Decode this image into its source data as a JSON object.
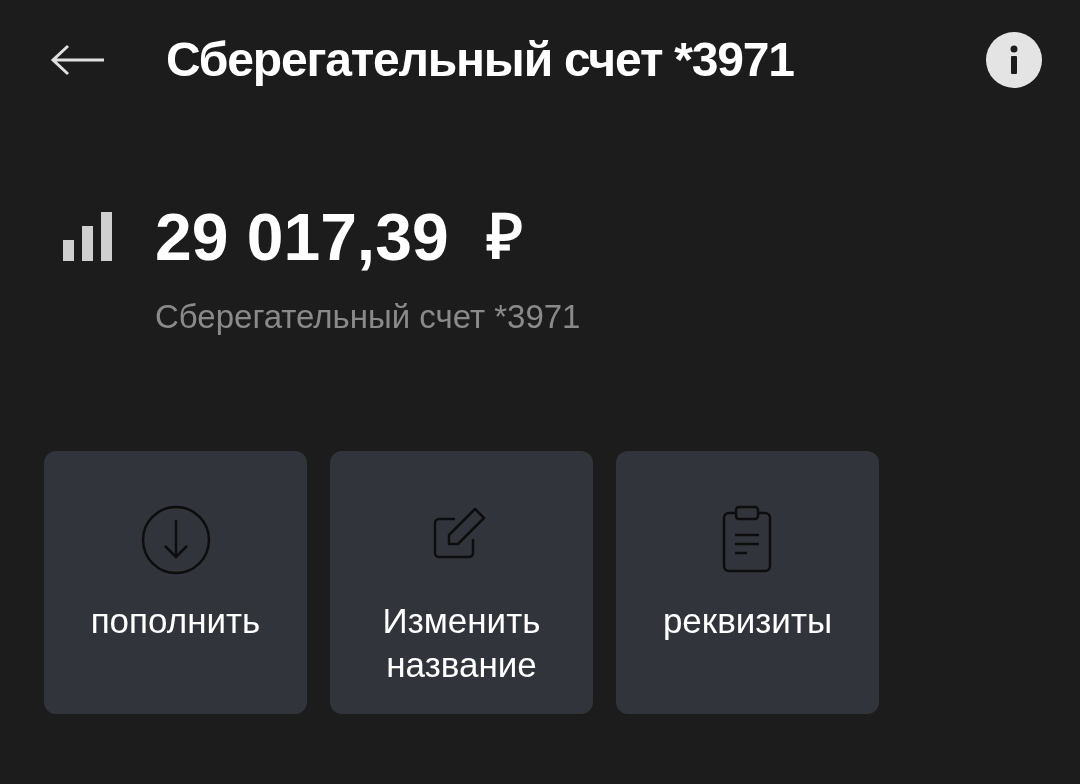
{
  "header": {
    "title": "Сберегательный счет *3971"
  },
  "balance": {
    "amount": "29 017,39",
    "currency": "₽",
    "account_name": "Сберегательный счет *3971"
  },
  "actions": [
    {
      "kind": "deposit",
      "label": "пополнить"
    },
    {
      "kind": "rename",
      "label": "Изменить название"
    },
    {
      "kind": "details",
      "label": "реквизиты"
    }
  ]
}
